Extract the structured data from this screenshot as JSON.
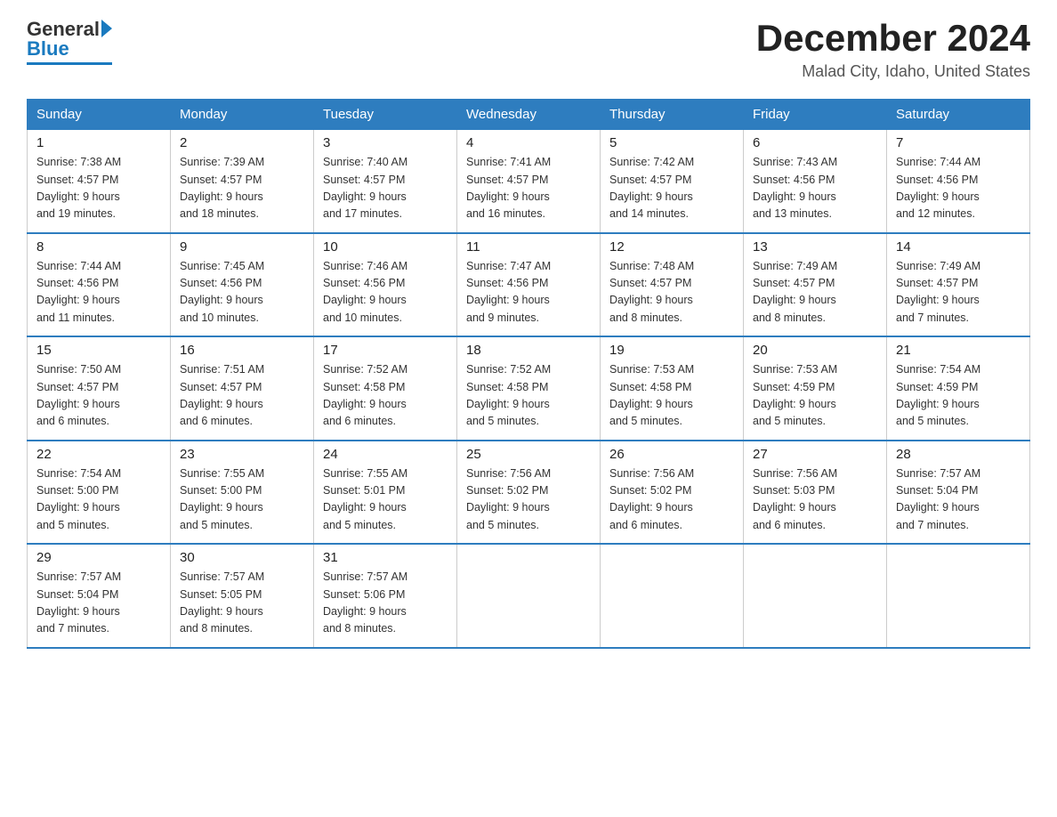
{
  "logo": {
    "general": "General",
    "blue": "Blue"
  },
  "title": {
    "month_year": "December 2024",
    "location": "Malad City, Idaho, United States"
  },
  "weekdays": [
    "Sunday",
    "Monday",
    "Tuesday",
    "Wednesday",
    "Thursday",
    "Friday",
    "Saturday"
  ],
  "weeks": [
    [
      {
        "day": "1",
        "sunrise": "7:38 AM",
        "sunset": "4:57 PM",
        "daylight": "9 hours and 19 minutes."
      },
      {
        "day": "2",
        "sunrise": "7:39 AM",
        "sunset": "4:57 PM",
        "daylight": "9 hours and 18 minutes."
      },
      {
        "day": "3",
        "sunrise": "7:40 AM",
        "sunset": "4:57 PM",
        "daylight": "9 hours and 17 minutes."
      },
      {
        "day": "4",
        "sunrise": "7:41 AM",
        "sunset": "4:57 PM",
        "daylight": "9 hours and 16 minutes."
      },
      {
        "day": "5",
        "sunrise": "7:42 AM",
        "sunset": "4:57 PM",
        "daylight": "9 hours and 14 minutes."
      },
      {
        "day": "6",
        "sunrise": "7:43 AM",
        "sunset": "4:56 PM",
        "daylight": "9 hours and 13 minutes."
      },
      {
        "day": "7",
        "sunrise": "7:44 AM",
        "sunset": "4:56 PM",
        "daylight": "9 hours and 12 minutes."
      }
    ],
    [
      {
        "day": "8",
        "sunrise": "7:44 AM",
        "sunset": "4:56 PM",
        "daylight": "9 hours and 11 minutes."
      },
      {
        "day": "9",
        "sunrise": "7:45 AM",
        "sunset": "4:56 PM",
        "daylight": "9 hours and 10 minutes."
      },
      {
        "day": "10",
        "sunrise": "7:46 AM",
        "sunset": "4:56 PM",
        "daylight": "9 hours and 10 minutes."
      },
      {
        "day": "11",
        "sunrise": "7:47 AM",
        "sunset": "4:56 PM",
        "daylight": "9 hours and 9 minutes."
      },
      {
        "day": "12",
        "sunrise": "7:48 AM",
        "sunset": "4:57 PM",
        "daylight": "9 hours and 8 minutes."
      },
      {
        "day": "13",
        "sunrise": "7:49 AM",
        "sunset": "4:57 PM",
        "daylight": "9 hours and 8 minutes."
      },
      {
        "day": "14",
        "sunrise": "7:49 AM",
        "sunset": "4:57 PM",
        "daylight": "9 hours and 7 minutes."
      }
    ],
    [
      {
        "day": "15",
        "sunrise": "7:50 AM",
        "sunset": "4:57 PM",
        "daylight": "9 hours and 6 minutes."
      },
      {
        "day": "16",
        "sunrise": "7:51 AM",
        "sunset": "4:57 PM",
        "daylight": "9 hours and 6 minutes."
      },
      {
        "day": "17",
        "sunrise": "7:52 AM",
        "sunset": "4:58 PM",
        "daylight": "9 hours and 6 minutes."
      },
      {
        "day": "18",
        "sunrise": "7:52 AM",
        "sunset": "4:58 PM",
        "daylight": "9 hours and 5 minutes."
      },
      {
        "day": "19",
        "sunrise": "7:53 AM",
        "sunset": "4:58 PM",
        "daylight": "9 hours and 5 minutes."
      },
      {
        "day": "20",
        "sunrise": "7:53 AM",
        "sunset": "4:59 PM",
        "daylight": "9 hours and 5 minutes."
      },
      {
        "day": "21",
        "sunrise": "7:54 AM",
        "sunset": "4:59 PM",
        "daylight": "9 hours and 5 minutes."
      }
    ],
    [
      {
        "day": "22",
        "sunrise": "7:54 AM",
        "sunset": "5:00 PM",
        "daylight": "9 hours and 5 minutes."
      },
      {
        "day": "23",
        "sunrise": "7:55 AM",
        "sunset": "5:00 PM",
        "daylight": "9 hours and 5 minutes."
      },
      {
        "day": "24",
        "sunrise": "7:55 AM",
        "sunset": "5:01 PM",
        "daylight": "9 hours and 5 minutes."
      },
      {
        "day": "25",
        "sunrise": "7:56 AM",
        "sunset": "5:02 PM",
        "daylight": "9 hours and 5 minutes."
      },
      {
        "day": "26",
        "sunrise": "7:56 AM",
        "sunset": "5:02 PM",
        "daylight": "9 hours and 6 minutes."
      },
      {
        "day": "27",
        "sunrise": "7:56 AM",
        "sunset": "5:03 PM",
        "daylight": "9 hours and 6 minutes."
      },
      {
        "day": "28",
        "sunrise": "7:57 AM",
        "sunset": "5:04 PM",
        "daylight": "9 hours and 7 minutes."
      }
    ],
    [
      {
        "day": "29",
        "sunrise": "7:57 AM",
        "sunset": "5:04 PM",
        "daylight": "9 hours and 7 minutes."
      },
      {
        "day": "30",
        "sunrise": "7:57 AM",
        "sunset": "5:05 PM",
        "daylight": "9 hours and 8 minutes."
      },
      {
        "day": "31",
        "sunrise": "7:57 AM",
        "sunset": "5:06 PM",
        "daylight": "9 hours and 8 minutes."
      },
      null,
      null,
      null,
      null
    ]
  ],
  "labels": {
    "sunrise": "Sunrise:",
    "sunset": "Sunset:",
    "daylight": "Daylight:"
  }
}
